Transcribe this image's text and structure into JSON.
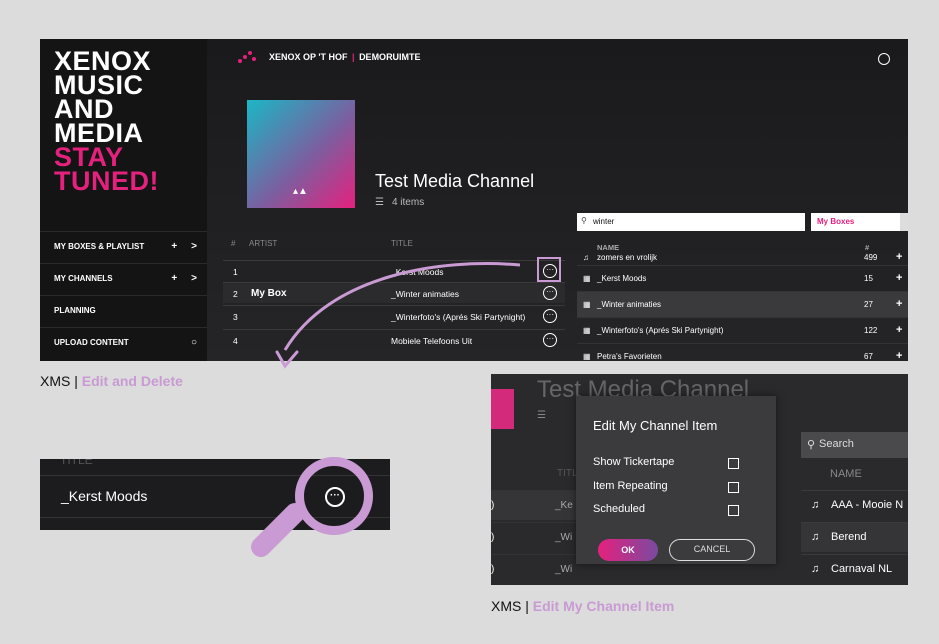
{
  "colors": {
    "accent_pink": "#e5217e",
    "highlight_lilac": "#c99ad3",
    "background": "#dcdcdc"
  },
  "sidebar": {
    "brand_lines": [
      "XENOX",
      "MUSIC",
      "AND",
      "MEDIA"
    ],
    "brand_pink_lines": [
      "STAY",
      "TUNED!"
    ],
    "items": [
      {
        "label": "MY BOXES & PLAYLIST",
        "actions": [
          "+",
          ">"
        ]
      },
      {
        "label": "MY CHANNELS",
        "actions": [
          "+",
          ">"
        ]
      },
      {
        "label": "PLANNING"
      },
      {
        "label": "UPLOAD CONTENT",
        "actions": [
          "○"
        ]
      }
    ]
  },
  "header": {
    "crumb_main": "XENOX OP 'T HOF",
    "crumb_sep": "|",
    "crumb_sub": "DEMORUIMTE",
    "user_icon": "user-icon"
  },
  "channel": {
    "title": "Test Media Channel",
    "count": "4 items"
  },
  "table": {
    "headers": {
      "num": "#",
      "artist": "ARTIST",
      "title": "TITLE"
    },
    "rows": [
      {
        "num": "1",
        "artist": "",
        "title": "_Kerst Moods"
      },
      {
        "num": "2",
        "artist": "My Box",
        "title": "_Winter animaties"
      },
      {
        "num": "3",
        "artist": "",
        "title": "_Winterfoto's (Aprés Ski Partynight)"
      },
      {
        "num": "4",
        "artist": "",
        "title": "Mobiele Telefoons Uit"
      }
    ]
  },
  "right_panel": {
    "search_value": "winter",
    "select_value": "My Boxes",
    "headers": {
      "name": "NAME",
      "count": "#"
    },
    "rows": [
      {
        "icon": "music-icon",
        "name": "zomers en vrolijk",
        "count": "499"
      },
      {
        "icon": "film-icon",
        "name": "_Kerst Moods",
        "count": "15"
      },
      {
        "icon": "film-icon",
        "name": "_Winter animaties",
        "count": "27"
      },
      {
        "icon": "film-icon",
        "name": "_Winterfoto's (Aprés Ski Partynight)",
        "count": "122"
      },
      {
        "icon": "film-icon",
        "name": "Petra's Favorieten",
        "count": "67"
      }
    ]
  },
  "captions": {
    "first_prefix": "XMS | ",
    "first_highlight": "Edit and Delete",
    "second_prefix": "XMS | ",
    "second_highlight": "Edit My Channel Item"
  },
  "zoom": {
    "faint_header": "TITLE",
    "row_title": "_Kerst Moods"
  },
  "dialog_shot": {
    "bg_title": "Test Media Channel",
    "col_title": "TITL",
    "left_rows": [
      {
        "paren": ")",
        "k": "_Ke"
      },
      {
        "paren": ")",
        "k": "_Wi"
      },
      {
        "paren": ")",
        "k": "_Wi"
      }
    ],
    "search_placeholder": "Search",
    "name_header": "NAME",
    "right_rows": [
      "AAA - Mooie N",
      "Berend",
      "Carnaval NL"
    ],
    "dialog": {
      "title": "Edit My Channel Item",
      "options": [
        "Show Tickertape",
        "Item Repeating",
        "Scheduled"
      ],
      "ok": "OK",
      "cancel": "CANCEL"
    }
  }
}
